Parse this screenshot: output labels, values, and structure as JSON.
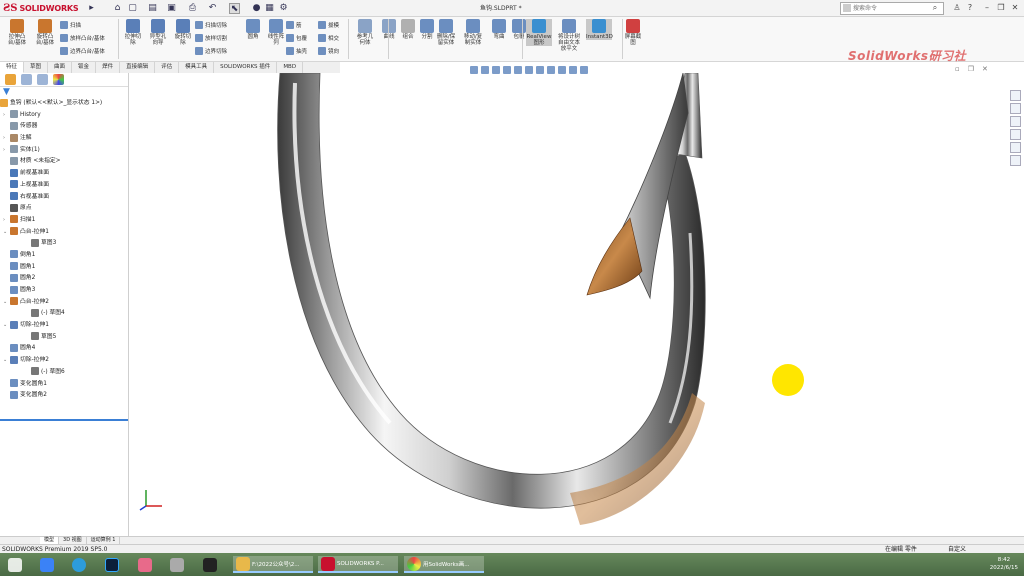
{
  "app": {
    "logo": "SOLIDWORKS",
    "doc_title": "鱼钩.SLDPRT *",
    "search_placeholder": "搜索命令"
  },
  "ribbon": {
    "large": [
      {
        "label": "拉伸凸\n台/基体",
        "icon": "extrude-boss-icon",
        "color": "#c9762e"
      },
      {
        "label": "旋转凸\n台/基体",
        "icon": "revolve-boss-icon",
        "color": "#c9762e"
      },
      {
        "label": "拉伸切\n除",
        "icon": "extrude-cut-icon",
        "color": "#5a7fb8"
      },
      {
        "label": "异型孔\n向导",
        "icon": "hole-wizard-icon",
        "color": "#5a7fb8"
      },
      {
        "label": "旋转切\n除",
        "icon": "revolve-cut-icon",
        "color": "#5a7fb8"
      },
      {
        "label": "圆角",
        "icon": "fillet-icon",
        "color": "#6b8ec0"
      },
      {
        "label": "线性阵\n列",
        "icon": "linear-pattern-icon",
        "color": "#6b8ec0"
      },
      {
        "label": "参考几\n何体",
        "icon": "reference-geometry-icon",
        "color": "#8aa3c6"
      },
      {
        "label": "曲线",
        "icon": "curves-icon",
        "color": "#8aa3c6"
      },
      {
        "label": "组合",
        "icon": "combine-icon",
        "color": "#b0b0b0"
      },
      {
        "label": "分割",
        "icon": "split-icon",
        "color": "#6b8ec0"
      },
      {
        "label": "删除/保\n留实体",
        "icon": "delete-body-icon",
        "color": "#6b8ec0"
      },
      {
        "label": "移动/复\n制实体",
        "icon": "move-copy-icon",
        "color": "#6b8ec0"
      },
      {
        "label": "弯曲",
        "icon": "flex-icon",
        "color": "#6b8ec0"
      },
      {
        "label": "包覆",
        "icon": "wrap-icon",
        "color": "#6b8ec0"
      },
      {
        "label": "RealView\n图形",
        "icon": "realview-icon",
        "color": "#3a8fd0"
      },
      {
        "label": "将设计树\n自由文本\n放平文",
        "icon": "text-icon",
        "color": "#6b8ec0"
      },
      {
        "label": "Instant3D",
        "icon": "instant3d-icon",
        "color": "#3a8fd0"
      },
      {
        "label": "屏幕截\n图",
        "icon": "screen-capture-icon",
        "color": "#d04040"
      }
    ],
    "small": [
      "扫描",
      "放样凸台/基体",
      "边界凸台/基体",
      "扫描切除",
      "放样切割",
      "边界切除",
      "筋",
      "包覆",
      "抽壳",
      "拔模",
      "相交",
      "镜向"
    ]
  },
  "brand_text": "SolidWorks研习社",
  "command_tabs": [
    "特征",
    "草图",
    "曲面",
    "钣金",
    "焊件",
    "直接编辑",
    "评估",
    "模具工具",
    "SOLIDWORKS 插件",
    "MBD"
  ],
  "tree": {
    "root": "鱼钩 (默认<<默认>_显示状态 1>)",
    "items": [
      {
        "label": "History",
        "color": "#8899aa",
        "arrow": "›"
      },
      {
        "label": "传感器",
        "color": "#8899aa",
        "arrow": ""
      },
      {
        "label": "注解",
        "color": "#aa8866",
        "arrow": "›"
      },
      {
        "label": "实体(1)",
        "color": "#8899aa",
        "arrow": "›"
      },
      {
        "label": "材质 <未指定>",
        "color": "#8899aa",
        "arrow": ""
      },
      {
        "label": "前视基准面",
        "color": "#4a78b8",
        "arrow": ""
      },
      {
        "label": "上视基准面",
        "color": "#4a78b8",
        "arrow": ""
      },
      {
        "label": "右视基准面",
        "color": "#4a78b8",
        "arrow": ""
      },
      {
        "label": "原点",
        "color": "#555555",
        "arrow": ""
      },
      {
        "label": "扫描1",
        "color": "#c9762e",
        "arrow": "›"
      },
      {
        "label": "凸台-拉伸1",
        "color": "#c9762e",
        "arrow": "⌄"
      },
      {
        "label": "草图3",
        "color": "#777777",
        "arrow": "",
        "indent": 2
      },
      {
        "label": "倒角1",
        "color": "#6b8ec0",
        "arrow": ""
      },
      {
        "label": "圆角1",
        "color": "#6b8ec0",
        "arrow": ""
      },
      {
        "label": "圆角2",
        "color": "#6b8ec0",
        "arrow": ""
      },
      {
        "label": "圆角3",
        "color": "#6b8ec0",
        "arrow": ""
      },
      {
        "label": "凸台-拉伸2",
        "color": "#c9762e",
        "arrow": "⌄"
      },
      {
        "label": "(-) 草图4",
        "color": "#777777",
        "arrow": "",
        "indent": 2
      },
      {
        "label": "切除-拉伸1",
        "color": "#5a7fb8",
        "arrow": "⌄"
      },
      {
        "label": "草图5",
        "color": "#777777",
        "arrow": "",
        "indent": 2
      },
      {
        "label": "圆角4",
        "color": "#6b8ec0",
        "arrow": ""
      },
      {
        "label": "切除-拉伸2",
        "color": "#5a7fb8",
        "arrow": "⌄"
      },
      {
        "label": "(-) 草图6",
        "color": "#777777",
        "arrow": "",
        "indent": 2
      },
      {
        "label": "变化圆角1",
        "color": "#6b8ec0",
        "arrow": ""
      },
      {
        "label": "变化圆角2",
        "color": "#6b8ec0",
        "arrow": ""
      }
    ]
  },
  "bottom_tabs": [
    "模型",
    "3D 视图",
    "运动算例 1"
  ],
  "status": {
    "left": "SOLIDWORKS Premium 2019 SP5.0",
    "mode": "在编辑 零件",
    "units": "自定义"
  },
  "taskbar": {
    "windows": [
      "F:\\2022公众号\\2...",
      "SOLIDWORKS P...",
      "用SolidWorks画..."
    ],
    "time": "8:42",
    "date": "2022/6/15"
  }
}
